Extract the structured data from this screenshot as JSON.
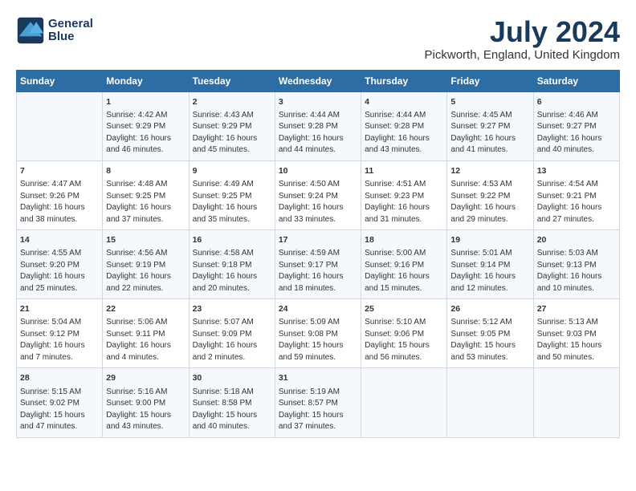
{
  "logo": {
    "line1": "General",
    "line2": "Blue"
  },
  "title": "July 2024",
  "subtitle": "Pickworth, England, United Kingdom",
  "weekdays": [
    "Sunday",
    "Monday",
    "Tuesday",
    "Wednesday",
    "Thursday",
    "Friday",
    "Saturday"
  ],
  "rows": [
    [
      {
        "day": "",
        "info": ""
      },
      {
        "day": "1",
        "info": "Sunrise: 4:42 AM\nSunset: 9:29 PM\nDaylight: 16 hours\nand 46 minutes."
      },
      {
        "day": "2",
        "info": "Sunrise: 4:43 AM\nSunset: 9:29 PM\nDaylight: 16 hours\nand 45 minutes."
      },
      {
        "day": "3",
        "info": "Sunrise: 4:44 AM\nSunset: 9:28 PM\nDaylight: 16 hours\nand 44 minutes."
      },
      {
        "day": "4",
        "info": "Sunrise: 4:44 AM\nSunset: 9:28 PM\nDaylight: 16 hours\nand 43 minutes."
      },
      {
        "day": "5",
        "info": "Sunrise: 4:45 AM\nSunset: 9:27 PM\nDaylight: 16 hours\nand 41 minutes."
      },
      {
        "day": "6",
        "info": "Sunrise: 4:46 AM\nSunset: 9:27 PM\nDaylight: 16 hours\nand 40 minutes."
      }
    ],
    [
      {
        "day": "7",
        "info": "Sunrise: 4:47 AM\nSunset: 9:26 PM\nDaylight: 16 hours\nand 38 minutes."
      },
      {
        "day": "8",
        "info": "Sunrise: 4:48 AM\nSunset: 9:25 PM\nDaylight: 16 hours\nand 37 minutes."
      },
      {
        "day": "9",
        "info": "Sunrise: 4:49 AM\nSunset: 9:25 PM\nDaylight: 16 hours\nand 35 minutes."
      },
      {
        "day": "10",
        "info": "Sunrise: 4:50 AM\nSunset: 9:24 PM\nDaylight: 16 hours\nand 33 minutes."
      },
      {
        "day": "11",
        "info": "Sunrise: 4:51 AM\nSunset: 9:23 PM\nDaylight: 16 hours\nand 31 minutes."
      },
      {
        "day": "12",
        "info": "Sunrise: 4:53 AM\nSunset: 9:22 PM\nDaylight: 16 hours\nand 29 minutes."
      },
      {
        "day": "13",
        "info": "Sunrise: 4:54 AM\nSunset: 9:21 PM\nDaylight: 16 hours\nand 27 minutes."
      }
    ],
    [
      {
        "day": "14",
        "info": "Sunrise: 4:55 AM\nSunset: 9:20 PM\nDaylight: 16 hours\nand 25 minutes."
      },
      {
        "day": "15",
        "info": "Sunrise: 4:56 AM\nSunset: 9:19 PM\nDaylight: 16 hours\nand 22 minutes."
      },
      {
        "day": "16",
        "info": "Sunrise: 4:58 AM\nSunset: 9:18 PM\nDaylight: 16 hours\nand 20 minutes."
      },
      {
        "day": "17",
        "info": "Sunrise: 4:59 AM\nSunset: 9:17 PM\nDaylight: 16 hours\nand 18 minutes."
      },
      {
        "day": "18",
        "info": "Sunrise: 5:00 AM\nSunset: 9:16 PM\nDaylight: 16 hours\nand 15 minutes."
      },
      {
        "day": "19",
        "info": "Sunrise: 5:01 AM\nSunset: 9:14 PM\nDaylight: 16 hours\nand 12 minutes."
      },
      {
        "day": "20",
        "info": "Sunrise: 5:03 AM\nSunset: 9:13 PM\nDaylight: 16 hours\nand 10 minutes."
      }
    ],
    [
      {
        "day": "21",
        "info": "Sunrise: 5:04 AM\nSunset: 9:12 PM\nDaylight: 16 hours\nand 7 minutes."
      },
      {
        "day": "22",
        "info": "Sunrise: 5:06 AM\nSunset: 9:11 PM\nDaylight: 16 hours\nand 4 minutes."
      },
      {
        "day": "23",
        "info": "Sunrise: 5:07 AM\nSunset: 9:09 PM\nDaylight: 16 hours\nand 2 minutes."
      },
      {
        "day": "24",
        "info": "Sunrise: 5:09 AM\nSunset: 9:08 PM\nDaylight: 15 hours\nand 59 minutes."
      },
      {
        "day": "25",
        "info": "Sunrise: 5:10 AM\nSunset: 9:06 PM\nDaylight: 15 hours\nand 56 minutes."
      },
      {
        "day": "26",
        "info": "Sunrise: 5:12 AM\nSunset: 9:05 PM\nDaylight: 15 hours\nand 53 minutes."
      },
      {
        "day": "27",
        "info": "Sunrise: 5:13 AM\nSunset: 9:03 PM\nDaylight: 15 hours\nand 50 minutes."
      }
    ],
    [
      {
        "day": "28",
        "info": "Sunrise: 5:15 AM\nSunset: 9:02 PM\nDaylight: 15 hours\nand 47 minutes."
      },
      {
        "day": "29",
        "info": "Sunrise: 5:16 AM\nSunset: 9:00 PM\nDaylight: 15 hours\nand 43 minutes."
      },
      {
        "day": "30",
        "info": "Sunrise: 5:18 AM\nSunset: 8:58 PM\nDaylight: 15 hours\nand 40 minutes."
      },
      {
        "day": "31",
        "info": "Sunrise: 5:19 AM\nSunset: 8:57 PM\nDaylight: 15 hours\nand 37 minutes."
      },
      {
        "day": "",
        "info": ""
      },
      {
        "day": "",
        "info": ""
      },
      {
        "day": "",
        "info": ""
      }
    ]
  ]
}
